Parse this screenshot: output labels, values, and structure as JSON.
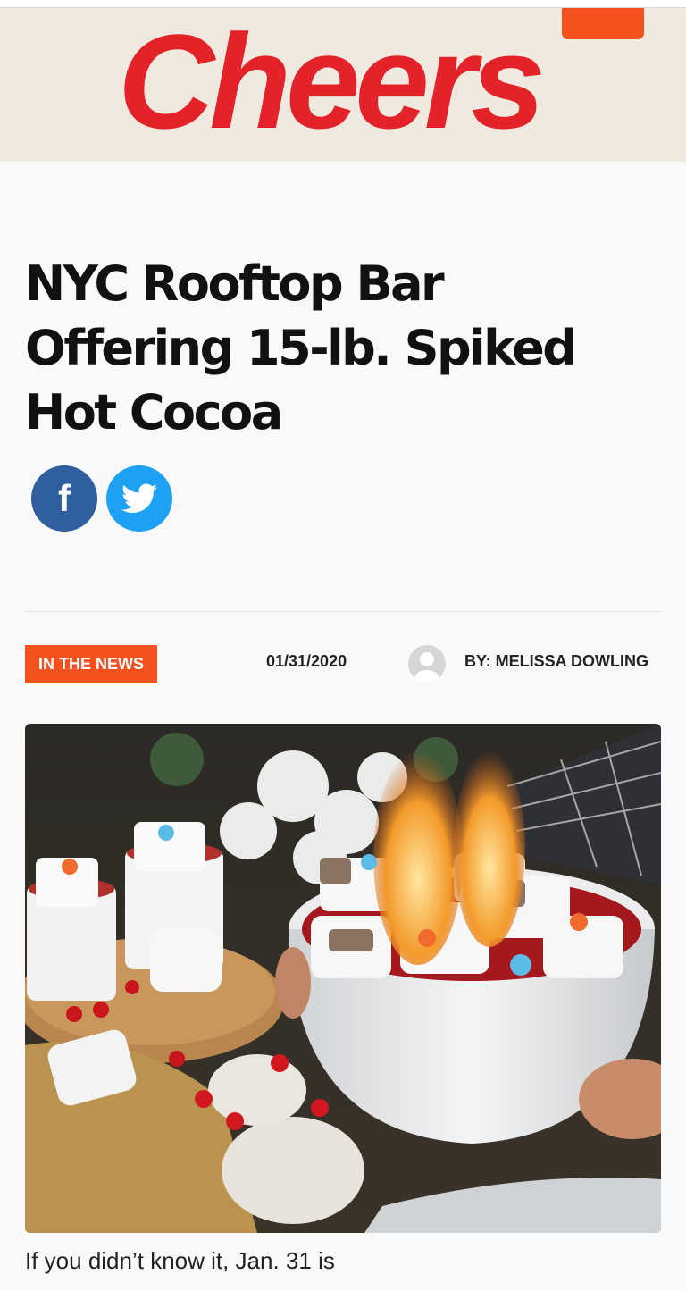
{
  "header": {
    "logo_text": "Cheers",
    "logo_color": "#e3222a",
    "background": "#f0e9e0",
    "menu_button_icon": "menu-icon",
    "menu_button_color": "#f4511e"
  },
  "article": {
    "title_lines": [
      "NYC Rooftop Bar",
      "Offering 15-lb. Spiked",
      "Hot Cocoa"
    ],
    "share": [
      {
        "name": "facebook-icon",
        "glyph": "f",
        "color": "#2f5f9e"
      },
      {
        "name": "twitter-icon",
        "color": "#1da1f2"
      }
    ],
    "category": "IN THE NEWS",
    "category_color": "#f4511e",
    "date": "01/31/2020",
    "author_avatar_icon": "user-avatar-icon",
    "author": "BY: MELISSA DOWLING",
    "hero_image": "giant-hot-cocoa-bowl-with-flaming-marshmallows",
    "body_start": "If you didn’t know it, Jan. 31 is"
  }
}
